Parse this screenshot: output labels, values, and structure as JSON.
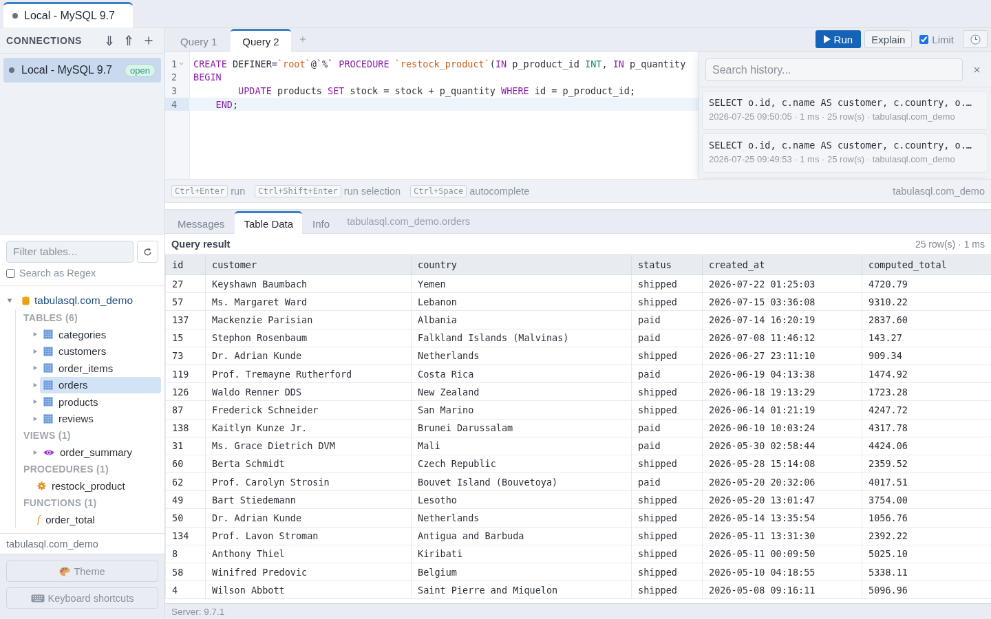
{
  "app_tabs": [
    {
      "label": "Local - MySQL 9.7",
      "selected": true
    }
  ],
  "sidebar": {
    "connections_title": "CONNECTIONS",
    "connections": [
      {
        "name": "Local - MySQL 9.7",
        "status": "open",
        "selected": true
      }
    ],
    "filter": {
      "placeholder": "Filter tables..."
    },
    "regex": {
      "label": "Search as Regex",
      "checked": false
    },
    "tree": [
      {
        "kind": "database",
        "name": "tabulasql.com_demo",
        "expanded": true,
        "selected": false,
        "children": [
          {
            "kind": "group",
            "name": "TABLES (6)",
            "children": [
              {
                "kind": "table",
                "name": "categories",
                "expanded": false,
                "selected": false
              },
              {
                "kind": "table",
                "name": "customers",
                "expanded": false,
                "selected": false
              },
              {
                "kind": "table",
                "name": "order_items",
                "expanded": false,
                "selected": false
              },
              {
                "kind": "table",
                "name": "orders",
                "expanded": false,
                "selected": true
              },
              {
                "kind": "table",
                "name": "products",
                "expanded": false,
                "selected": false
              },
              {
                "kind": "table",
                "name": "reviews",
                "expanded": false,
                "selected": false
              }
            ]
          },
          {
            "kind": "group",
            "name": "VIEWS (1)",
            "children": [
              {
                "kind": "view",
                "name": "order_summary",
                "expanded": false,
                "selected": false
              }
            ]
          },
          {
            "kind": "group",
            "name": "PROCEDURES (1)",
            "children": [
              {
                "kind": "procedure",
                "name": "restock_product",
                "selected": false
              }
            ]
          },
          {
            "kind": "group",
            "name": "FUNCTIONS (1)",
            "children": [
              {
                "kind": "function",
                "glyph": "f",
                "name": "order_total",
                "selected": false
              }
            ]
          }
        ]
      }
    ],
    "current_database": "tabulasql.com_demo",
    "buttons": [
      {
        "kind": "theme",
        "label": "Theme"
      },
      {
        "kind": "keyboard",
        "label": "Keyboard shortcuts"
      }
    ]
  },
  "query_tabs": [
    {
      "label": "Query 1",
      "selected": false
    },
    {
      "label": "Query 2",
      "selected": true
    }
  ],
  "toolbar": {
    "run": "Run",
    "explain": "Explain",
    "limit": {
      "label": "Limit",
      "checked": true
    }
  },
  "editor": {
    "lines": [
      {
        "number": "1",
        "foldable": true,
        "current": false,
        "tokens": [
          {
            "kind": "keyword",
            "text": "CREATE"
          },
          {
            "kind": "plain",
            "text": " DEFINER="
          },
          {
            "kind": "string",
            "text": "`root`"
          },
          {
            "kind": "plain",
            "text": "@`%` "
          },
          {
            "kind": "keyword",
            "text": "PROCEDURE"
          },
          {
            "kind": "string",
            "text": " `restock_product`"
          },
          {
            "kind": "plain",
            "text": "("
          },
          {
            "kind": "keyword",
            "text": "IN"
          },
          {
            "kind": "plain",
            "text": " p_product_id "
          },
          {
            "kind": "type",
            "text": "INT"
          },
          {
            "kind": "plain",
            "text": ", "
          },
          {
            "kind": "keyword",
            "text": "IN"
          },
          {
            "kind": "plain",
            "text": " p_quantity"
          }
        ]
      },
      {
        "number": "2",
        "foldable": false,
        "current": false,
        "tokens": [
          {
            "kind": "keyword",
            "text": "BEGIN"
          }
        ]
      },
      {
        "number": "3",
        "foldable": false,
        "current": false,
        "tokens": [
          {
            "kind": "keyword",
            "text": "        UPDATE"
          },
          {
            "kind": "plain",
            "text": " products "
          },
          {
            "kind": "keyword",
            "text": "SET"
          },
          {
            "kind": "plain",
            "text": " stock = stock + p_quantity "
          },
          {
            "kind": "keyword",
            "text": "WHERE"
          },
          {
            "kind": "plain",
            "text": " id = p_product_id;"
          }
        ]
      },
      {
        "number": "4",
        "foldable": false,
        "current": true,
        "tokens": [
          {
            "kind": "keyword",
            "text": "    END"
          },
          {
            "kind": "plain",
            "text": ";"
          }
        ]
      }
    ]
  },
  "shortcuts": [
    {
      "keys": "Ctrl+Enter",
      "action": "run"
    },
    {
      "keys": "Ctrl+Shift+Enter",
      "action": "run selection"
    },
    {
      "keys": "Ctrl+Space",
      "action": "autocomplete"
    }
  ],
  "editor_database": "tabulasql.com_demo",
  "history": {
    "search": {
      "placeholder": "Search history..."
    },
    "entries": [
      {
        "query": "SELECT o.id, c.name AS customer, c.country, o.…",
        "meta": "2026-07-25 09:50:05 · 1 ms · 25 row(s) · tabulasql.com_demo",
        "selected": false
      },
      {
        "query": "SELECT o.id, c.name AS customer, c.country, o.…",
        "meta": "2026-07-25 09:49:53 · 1 ms · 25 row(s) · tabulasql.com_demo",
        "selected": false
      }
    ]
  },
  "result_tabs": [
    {
      "label": "Messages",
      "selected": false
    },
    {
      "label": "Table Data",
      "selected": true
    },
    {
      "label": "Info",
      "selected": false
    }
  ],
  "result_source": "tabulasql.com_demo.orders",
  "result": {
    "title": "Query result",
    "summary": "25 row(s) · 1 ms",
    "columns": [
      "id",
      "customer",
      "country",
      "status",
      "created_at",
      "computed_total"
    ],
    "rows": [
      [
        "27",
        "Keyshawn Baumbach",
        "Yemen",
        "shipped",
        "2026-07-22 01:25:03",
        "4720.79"
      ],
      [
        "57",
        "Ms. Margaret Ward",
        "Lebanon",
        "shipped",
        "2026-07-15 03:36:08",
        "9310.22"
      ],
      [
        "137",
        "Mackenzie Parisian",
        "Albania",
        "paid",
        "2026-07-14 16:20:19",
        "2837.60"
      ],
      [
        "15",
        "Stephon Rosenbaum",
        "Falkland Islands (Malvinas)",
        "paid",
        "2026-07-08 11:46:12",
        "143.27"
      ],
      [
        "73",
        "Dr. Adrian Kunde",
        "Netherlands",
        "shipped",
        "2026-06-27 23:11:10",
        "909.34"
      ],
      [
        "119",
        "Prof. Tremayne Rutherford",
        "Costa Rica",
        "paid",
        "2026-06-19 04:13:38",
        "1474.92"
      ],
      [
        "126",
        "Waldo Renner DDS",
        "New Zealand",
        "shipped",
        "2026-06-18 19:13:29",
        "1723.28"
      ],
      [
        "87",
        "Frederick Schneider",
        "San Marino",
        "shipped",
        "2026-06-14 01:21:19",
        "4247.72"
      ],
      [
        "138",
        "Kaitlyn Kunze Jr.",
        "Brunei Darussalam",
        "paid",
        "2026-06-10 10:03:24",
        "4317.78"
      ],
      [
        "31",
        "Ms. Grace Dietrich DVM",
        "Mali",
        "paid",
        "2026-05-30 02:58:44",
        "4424.06"
      ],
      [
        "60",
        "Berta Schmidt",
        "Czech Republic",
        "shipped",
        "2026-05-28 15:14:08",
        "2359.52"
      ],
      [
        "62",
        "Prof. Carolyn Strosin",
        "Bouvet Island (Bouvetoya)",
        "paid",
        "2026-05-20 20:32:06",
        "4017.51"
      ],
      [
        "49",
        "Bart Stiedemann",
        "Lesotho",
        "shipped",
        "2026-05-20 13:01:47",
        "3754.00"
      ],
      [
        "50",
        "Dr. Adrian Kunde",
        "Netherlands",
        "shipped",
        "2026-05-14 13:35:54",
        "1056.76"
      ],
      [
        "134",
        "Prof. Lavon Stroman",
        "Antigua and Barbuda",
        "shipped",
        "2026-05-11 13:31:30",
        "2392.22"
      ],
      [
        "8",
        "Anthony Thiel",
        "Kiribati",
        "shipped",
        "2026-05-11 00:09:50",
        "5025.10"
      ],
      [
        "58",
        "Winifred Predovic",
        "Belgium",
        "shipped",
        "2026-05-10 04:18:55",
        "5338.11"
      ],
      [
        "4",
        "Wilson Abbott",
        "Saint Pierre and Miquelon",
        "shipped",
        "2026-05-08 09:16:11",
        "5096.96"
      ]
    ]
  },
  "status_bar": {
    "server": "Server: 9.7.1"
  }
}
